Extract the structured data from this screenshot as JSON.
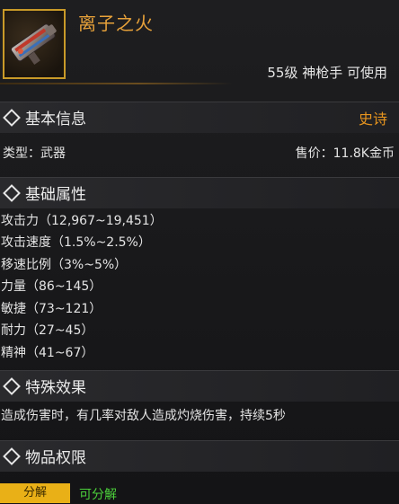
{
  "item": {
    "name": "离子之火",
    "requirement": "55级 神枪手 可使用",
    "icon": "weapon-gun-icon"
  },
  "basic": {
    "title": "基本信息",
    "rarity": "史诗",
    "type": "类型：武器",
    "price": "售价：11.8K金币"
  },
  "attributes": {
    "title": "基础属性",
    "lines": [
      "攻击力（12,967~19,451）",
      "攻击速度（1.5%~2.5%）",
      "移速比例（3%~5%）",
      "力量（86~145）",
      "敏捷（73~121）",
      "耐力（27~45）",
      "精神（41~67）"
    ]
  },
  "special": {
    "title": "特殊效果",
    "text": "造成伤害时，有几率对敌人造成灼烧伤害，持续5秒"
  },
  "permissions": {
    "title": "物品权限",
    "decompose_label": "分解",
    "decompose_status": "可分解"
  },
  "colors": {
    "rarity": "#e6941f",
    "name": "#e8a23a",
    "decompose_ok": "#4cd13b",
    "badge": "#e9b017"
  }
}
